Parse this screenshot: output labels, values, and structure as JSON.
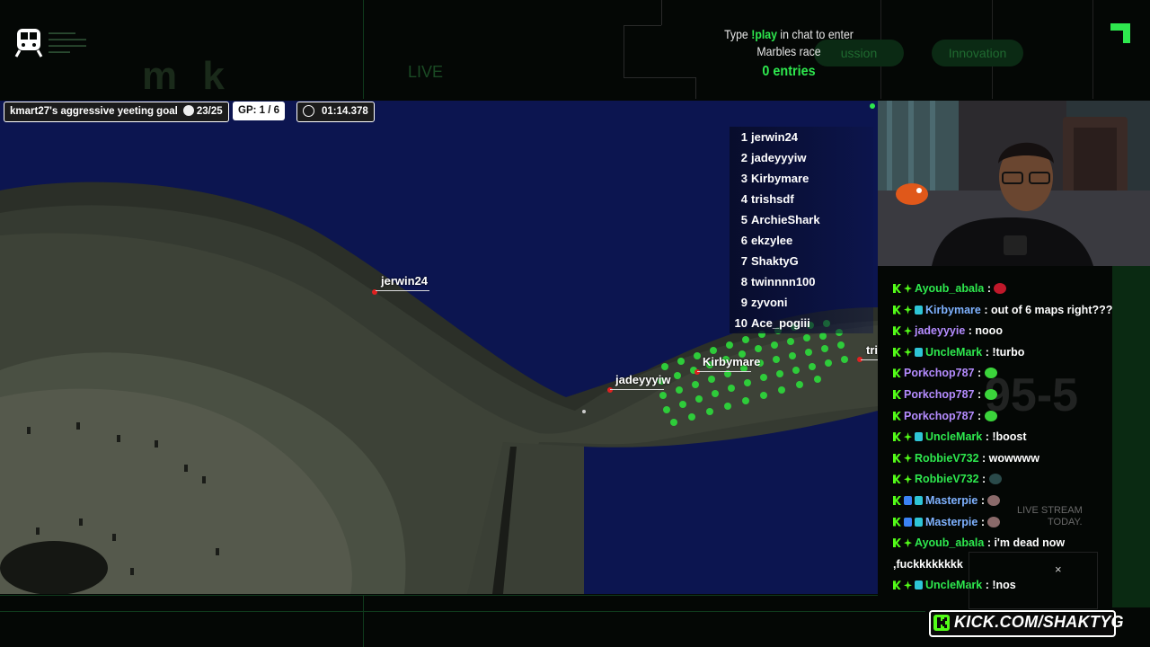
{
  "promo": {
    "line1_prefix": "Type ",
    "line1_cmd": "!play",
    "line1_suffix": " in chat to enter",
    "line2": "Marbles race",
    "entries": "0 entries"
  },
  "faint": {
    "live": "LIVE",
    "pill1": "ussion",
    "pill2": "Innovation",
    "score": "95-5",
    "live_stream": "LIVE STREAM",
    "today": "TODAY."
  },
  "hud": {
    "goal_label": "kmart27's aggressive yeeting goal",
    "goal_count": "23/25",
    "gp": "GP: 1 / 6",
    "time": "01:14.378"
  },
  "leaderboard": [
    {
      "rank": "1",
      "name": "jerwin24"
    },
    {
      "rank": "2",
      "name": "jadeyyyiw"
    },
    {
      "rank": "3",
      "name": "Kirbymare"
    },
    {
      "rank": "4",
      "name": "trishsdf"
    },
    {
      "rank": "5",
      "name": "ArchieShark"
    },
    {
      "rank": "6",
      "name": "ekzylee"
    },
    {
      "rank": "7",
      "name": "ShaktyG"
    },
    {
      "rank": "8",
      "name": "twinnnn100"
    },
    {
      "rank": "9",
      "name": "zyvoni"
    },
    {
      "rank": "10",
      "name": "Ace_pogiii"
    }
  ],
  "game_labels": {
    "p1": "jerwin24",
    "p2": "jadeyyyiw",
    "p3": "Kirbymare",
    "p4": "tri"
  },
  "chat": [
    {
      "user": "Ayoub_abala",
      "color": "#2ee84e",
      "text": "",
      "emote": "#c0182a",
      "badges": [
        "k",
        "star"
      ]
    },
    {
      "user": "Kirbymare",
      "color": "#7fb2ff",
      "text": "out of 6 maps right???",
      "emote": "",
      "badges": [
        "k",
        "star",
        "sq"
      ]
    },
    {
      "user": "jadeyyyie",
      "color": "#b58cff",
      "text": "nooo",
      "emote": "",
      "badges": [
        "k",
        "star"
      ]
    },
    {
      "user": "UncleMark",
      "color": "#2ee84e",
      "text": "!turbo",
      "emote": "",
      "badges": [
        "k",
        "star",
        "sq"
      ]
    },
    {
      "user": "Porkchop787",
      "color": "#b58cff",
      "text": "",
      "emote": "#3bd43b",
      "badges": [
        "k"
      ]
    },
    {
      "user": "Porkchop787",
      "color": "#b58cff",
      "text": "",
      "emote": "#3bd43b",
      "badges": [
        "k"
      ]
    },
    {
      "user": "Porkchop787",
      "color": "#b58cff",
      "text": "",
      "emote": "#3bd43b",
      "badges": [
        "k"
      ]
    },
    {
      "user": "UncleMark",
      "color": "#2ee84e",
      "text": "!boost",
      "emote": "",
      "badges": [
        "k",
        "star",
        "sq"
      ]
    },
    {
      "user": "RobbieV732",
      "color": "#2ee84e",
      "text": "wowwww",
      "emote": "",
      "badges": [
        "k",
        "star"
      ]
    },
    {
      "user": "RobbieV732",
      "color": "#2ee84e",
      "text": "",
      "emote": "#2a4a4a",
      "badges": [
        "k",
        "star"
      ]
    },
    {
      "user": "Masterpie",
      "color": "#7fb2ff",
      "text": "",
      "emote": "#8a6a6a",
      "badges": [
        "k",
        "blue",
        "sq"
      ]
    },
    {
      "user": "Masterpie",
      "color": "#7fb2ff",
      "text": "",
      "emote": "#8a6a6a",
      "badges": [
        "k",
        "blue",
        "sq"
      ]
    },
    {
      "user": "Ayoub_abala",
      "color": "#2ee84e",
      "text": "i'm dead now",
      "emote": "",
      "badges": [
        "k",
        "star"
      ]
    },
    {
      "user": "",
      "color": "#fff",
      "text": ",fuckkkkkkkk",
      "emote": "",
      "badges": []
    },
    {
      "user": "UncleMark",
      "color": "#2ee84e",
      "text": "!nos",
      "emote": "",
      "badges": [
        "k",
        "star",
        "sq"
      ]
    }
  ],
  "kick": {
    "url": "KICK.COM/SHAKTYG"
  },
  "close_glyph": "×",
  "colors": {
    "accent": "#2ee84e",
    "kick_green": "#53fc18",
    "game_bg": "#0c1550"
  }
}
